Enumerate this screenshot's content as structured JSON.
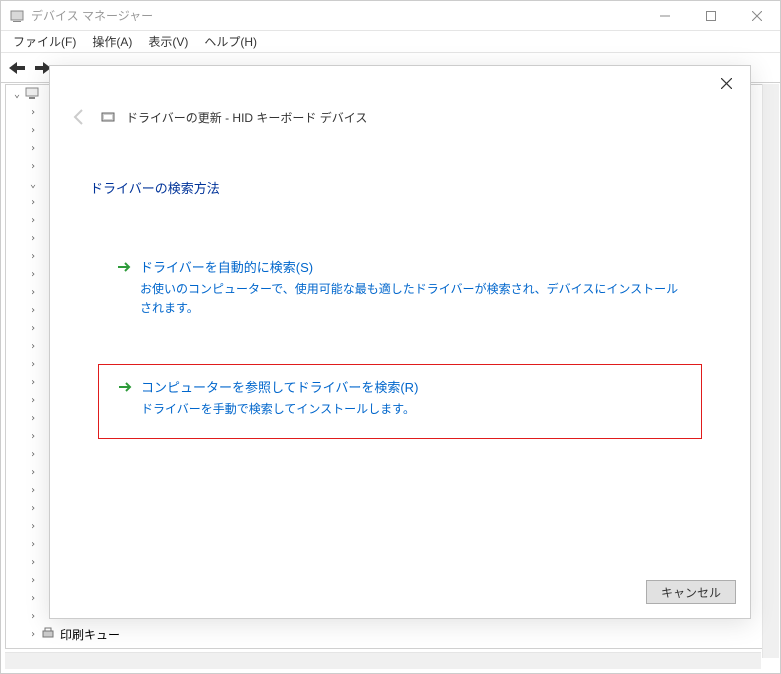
{
  "window": {
    "title": "デバイス マネージャー",
    "menu": {
      "file": "ファイル(F)",
      "action": "操作(A)",
      "view": "表示(V)",
      "help": "ヘルプ(H)"
    },
    "tree": {
      "last_item": "印刷キュー"
    }
  },
  "dialog": {
    "title": "ドライバーの更新 - HID キーボード デバイス",
    "section_heading": "ドライバーの検索方法",
    "option1": {
      "title": "ドライバーを自動的に検索(S)",
      "desc": "お使いのコンピューターで、使用可能な最も適したドライバーが検索され、デバイスにインストールされます。"
    },
    "option2": {
      "title": "コンピューターを参照してドライバーを検索(R)",
      "desc": "ドライバーを手動で検索してインストールします。"
    },
    "cancel": "キャンセル"
  }
}
